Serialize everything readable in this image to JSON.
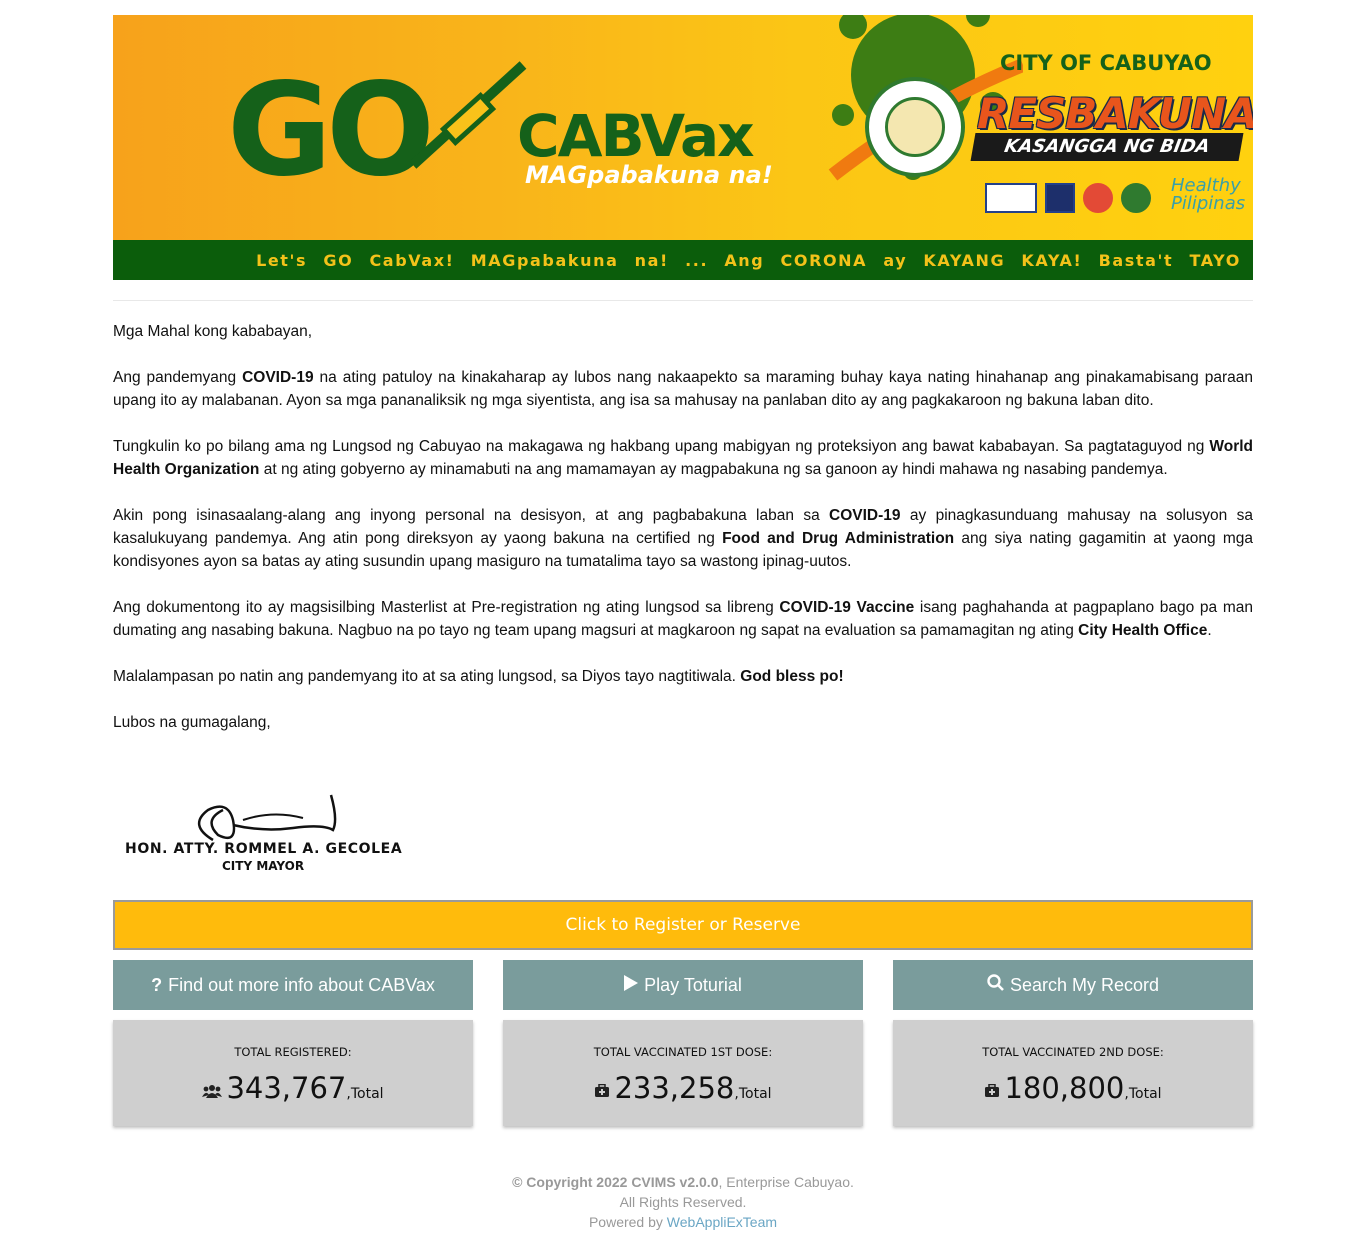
{
  "banner": {
    "go": "GO",
    "cabvax": "CABVax",
    "mag": "MAGpabakuna na!",
    "city": "CITY OF CABUYAO",
    "resbakuna": "RESBAKUNA",
    "kasangga": "KASANGGA NG BIDA",
    "healthy": "Healthy Pilipinas",
    "tagline": "Let's GO CabVax! MAGpabakuna na! ... Ang CORONA ay KAYANG KAYA! Basta't TAYO"
  },
  "letter": {
    "greeting": "Mga Mahal kong kababayan,",
    "p1": {
      "a": "Ang pandemyang ",
      "b1": "COVID-19",
      "c": " na ating patuloy na kinakaharap ay lubos nang nakaapekto sa maraming buhay kaya nating hinahanap ang pinakamabisang paraan upang ito ay malabanan. Ayon sa mga pananaliksik ng mga siyentista, ang isa sa mahusay na panlaban dito ay ang pagkakaroon ng bakuna laban dito."
    },
    "p2": {
      "a": "Tungkulin ko po bilang ama ng Lungsod ng Cabuyao na makagawa ng hakbang upang mabigyan ng proteksiyon ang bawat kababayan. Sa pagtataguyod ng ",
      "b1": "World Health Organization",
      "c": " at ng ating gobyerno ay minamabuti na ang mamamayan ay magpabakuna ng sa ganoon ay hindi mahawa ng nasabing pandemya."
    },
    "p3": {
      "a": "Akin pong isinasaalang-alang ang inyong personal na desisyon, at ang pagbabakuna laban sa ",
      "b1": "COVID-19",
      "c": " ay pinagkasunduang mahusay na solusyon sa kasalukuyang pandemya. Ang atin pong direksyon ay yaong bakuna na certified ng ",
      "b2": "Food and Drug Administration",
      "d": " ang siya nating gagamitin at yaong mga kondisyones ayon sa batas ay ating susundin upang masiguro na tumatalima tayo sa wastong ipinag-uutos."
    },
    "p4": {
      "a": "Ang dokumentong ito ay magsisilbing Masterlist at Pre-registration ng ating lungsod sa libreng ",
      "b1": "COVID-19 Vaccine",
      "c": " isang paghahanda at pagpaplano bago pa man dumating ang nasabing bakuna. Nagbuo na po tayo ng team upang magsuri at magkaroon ng sapat na evaluation sa pamamagitan ng ating ",
      "b2": "City Health Office",
      "d": "."
    },
    "p5": {
      "a": "Malalampasan po natin ang pandemyang ito at sa ating lungsod, sa Diyos tayo nagtitiwala. ",
      "b1": "God bless po!"
    },
    "closing": "Lubos na gumagalang,"
  },
  "signature": {
    "name": "HON. ATTY. ROMMEL A. GECOLEA",
    "title": "CITY MAYOR"
  },
  "actions": {
    "register_label": "Click to Register or Reserve",
    "info_label": "Find out more info about CABVax",
    "info_icon": "question-icon",
    "tutorial_label": "Play Toturial",
    "tutorial_icon": "play-icon",
    "search_label": "Search My Record",
    "search_icon": "search-icon"
  },
  "stats": [
    {
      "label": "TOTAL REGISTERED:",
      "value": "343,767",
      "unit": ",Total",
      "icon": "users-icon"
    },
    {
      "label": "TOTAL VACCINATED 1ST DOSE:",
      "value": "233,258",
      "unit": ",Total",
      "icon": "medkit-icon"
    },
    {
      "label": "TOTAL VACCINATED 2ND DOSE:",
      "value": "180,800",
      "unit": ",Total",
      "icon": "medkit-icon"
    }
  ],
  "footer": {
    "copyright_bold": "© Copyright 2022 CVIMS v2.0.0",
    "copyright_rest": ", Enterprise Cabuyao.",
    "rights": "All Rights Reserved.",
    "powered": "Powered by ",
    "team": "WebAppliExTeam"
  },
  "colors": {
    "banner_green": "#0b5d0b",
    "register_bg": "#ffbb0c",
    "button_bg": "#7a9c9c",
    "card_bg": "#cfcfcf",
    "link": "#6aa6c4"
  }
}
